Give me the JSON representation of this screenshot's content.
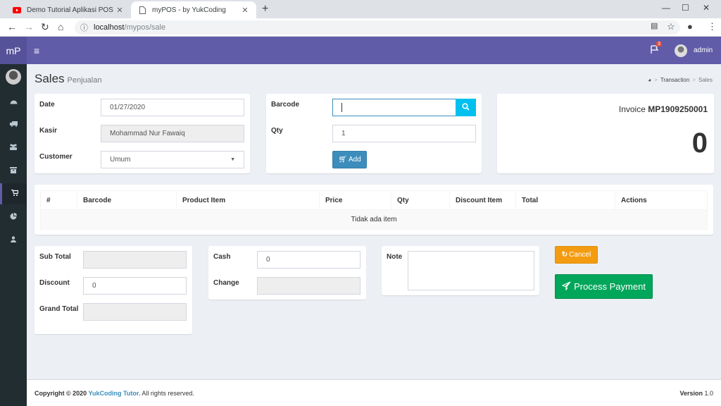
{
  "browser": {
    "tabs": [
      {
        "title": "Demo Tutorial Aplikasi POS (Po",
        "icon": "youtube-icon"
      },
      {
        "title": "myPOS - by YukCoding",
        "icon": "page-icon"
      }
    ],
    "url_host": "localhost",
    "url_path": "/mypos/sale"
  },
  "app": {
    "logo": "mP",
    "notification_count": "3",
    "user_name": "admin"
  },
  "sidebar": {
    "items": [
      {
        "name": "dashboard",
        "icon": "dashboard-icon"
      },
      {
        "name": "suppliers",
        "icon": "truck-icon"
      },
      {
        "name": "customers",
        "icon": "users-icon"
      },
      {
        "name": "products",
        "icon": "archive-icon"
      },
      {
        "name": "transaction",
        "icon": "cart-icon",
        "active": true
      },
      {
        "name": "reports",
        "icon": "pie-chart-icon"
      },
      {
        "name": "user",
        "icon": "user-icon"
      }
    ]
  },
  "page": {
    "title": "Sales",
    "subtitle": "Penjualan",
    "breadcrumb": [
      "Transaction",
      "Sales"
    ]
  },
  "form1": {
    "date_label": "Date",
    "date_value": "01/27/2020",
    "kasir_label": "Kasir",
    "kasir_value": "Mohammad Nur Fawaiq",
    "customer_label": "Customer",
    "customer_value": "Umum"
  },
  "form2": {
    "barcode_label": "Barcode",
    "barcode_value": "",
    "qty_label": "Qty",
    "qty_value": "1",
    "add_label": "Add"
  },
  "invoice": {
    "label": "Invoice",
    "number": "MP1909250001",
    "total": "0"
  },
  "table": {
    "headers": [
      "#",
      "Barcode",
      "Product Item",
      "Price",
      "Qty",
      "Discount Item",
      "Total",
      "Actions"
    ],
    "empty_text": "Tidak ada item"
  },
  "totals": {
    "subtotal_label": "Sub Total",
    "subtotal_value": "",
    "discount_label": "Discount",
    "discount_value": "0",
    "grandtotal_label": "Grand Total",
    "grandtotal_value": ""
  },
  "payment": {
    "cash_label": "Cash",
    "cash_value": "0",
    "change_label": "Change",
    "change_value": "",
    "note_label": "Note",
    "note_value": ""
  },
  "actions": {
    "cancel_label": "Cancel",
    "process_label": "Process Payment"
  },
  "footer": {
    "copyright": "Copyright © 2020 ",
    "brand": "YukCoding Tutor.",
    "rights": " All rights reserved.",
    "version_label": "Version",
    "version_value": "1.0"
  },
  "colors": {
    "header": "#605ca8",
    "sidebar": "#222d32",
    "primary": "#3c8dbc",
    "info": "#00c0ef",
    "warning": "#f39c12",
    "success": "#00a65a"
  }
}
